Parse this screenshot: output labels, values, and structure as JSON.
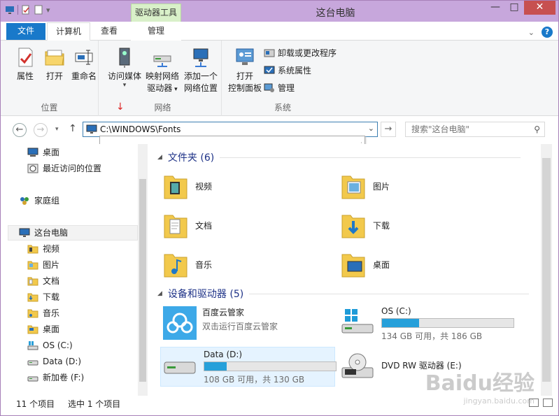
{
  "window": {
    "title": "这台电脑",
    "context_tab": "驱动器工具",
    "min": "—",
    "max": "□",
    "close": "✕"
  },
  "tabs": {
    "file": "文件",
    "computer": "计算机",
    "view": "查看",
    "manage": "管理"
  },
  "ribbon": {
    "location": {
      "label": "位置",
      "properties": "属性",
      "open": "打开",
      "rename": "重命名"
    },
    "network": {
      "label": "网络",
      "access_media": "访问媒体",
      "map_drive_1": "映射网络",
      "map_drive_2": "驱动器",
      "add_location_1": "添加一个",
      "add_location_2": "网络位置"
    },
    "system": {
      "label": "系统",
      "control_panel_1": "打开",
      "control_panel_2": "控制面板",
      "uninstall": "卸载或更改程序",
      "sys_props": "系统属性",
      "manage": "管理"
    }
  },
  "address": {
    "path": "C:\\WINDOWS\\Fonts",
    "search_placeholder": "搜索\"这台电脑\""
  },
  "nav": {
    "items": [
      {
        "label": "桌面",
        "icon": "desktop-icon"
      },
      {
        "label": "最近访问的位置",
        "icon": "recent-places-icon"
      },
      {
        "label": "家庭组",
        "icon": "homegroup-icon"
      },
      {
        "label": "这台电脑",
        "icon": "computer-icon"
      },
      {
        "label": "视频",
        "icon": "videos-folder-icon"
      },
      {
        "label": "图片",
        "icon": "pictures-folder-icon"
      },
      {
        "label": "文档",
        "icon": "documents-folder-icon"
      },
      {
        "label": "下载",
        "icon": "downloads-folder-icon"
      },
      {
        "label": "音乐",
        "icon": "music-folder-icon"
      },
      {
        "label": "桌面",
        "icon": "desktop-folder-icon"
      },
      {
        "label": "OS (C:)",
        "icon": "os-drive-icon"
      },
      {
        "label": "Data (D:)",
        "icon": "data-drive-icon"
      },
      {
        "label": "新加卷 (F:)",
        "icon": "drive-icon"
      }
    ]
  },
  "content": {
    "folders_header": "文件夹 (6)",
    "folders": [
      {
        "label": "视频"
      },
      {
        "label": "图片"
      },
      {
        "label": "文档"
      },
      {
        "label": "下载"
      },
      {
        "label": "音乐"
      },
      {
        "label": "桌面"
      }
    ],
    "devices_header": "设备和驱动器 (5)",
    "devices": {
      "baidu_name": "百度云管家",
      "baidu_sub": "双击运行百度云管家",
      "os_name": "OS (C:)",
      "os_sub": "134 GB 可用，共 186 GB",
      "os_used": 0.28,
      "data_name": "Data (D:)",
      "data_sub": "108 GB 可用，共 130 GB",
      "data_used": 0.17,
      "dvd_name": "DVD RW 驱动器 (E:)"
    }
  },
  "status": {
    "count": "11 个项目",
    "selected": "选中 1 个项目"
  },
  "colors": {
    "titlebar": "#c7a7dc",
    "file_tab": "#1979ca",
    "section_text": "#1e3287",
    "bar_fill": "#26a0da"
  }
}
